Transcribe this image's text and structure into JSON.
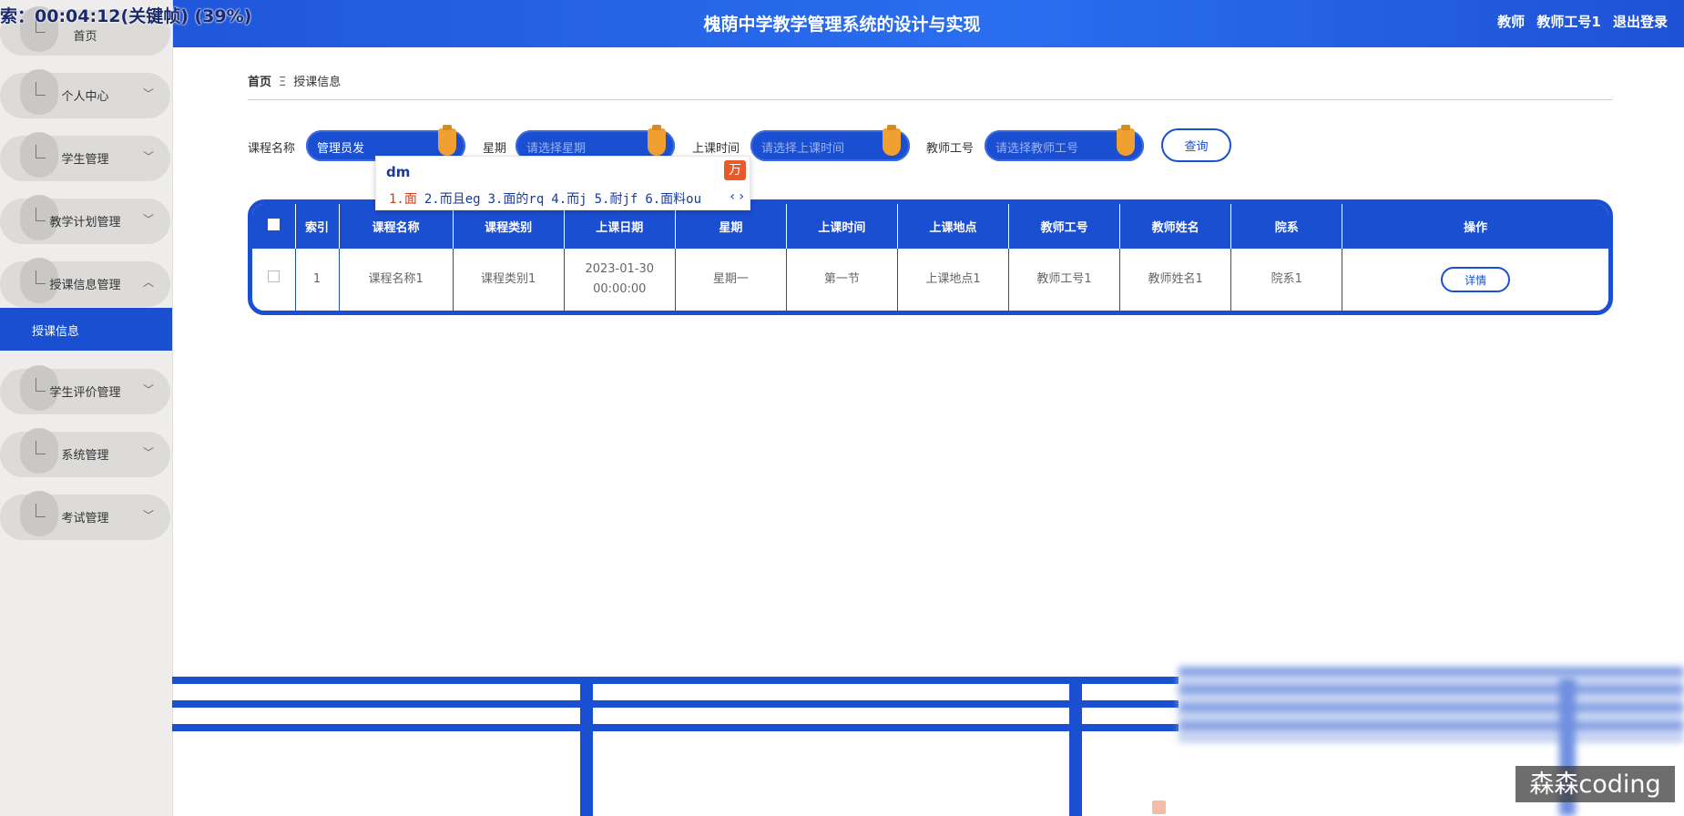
{
  "overlay_timestamp": "索：00:04:12(关键帧) (39%)",
  "header": {
    "title": "槐荫中学教学管理系统的设计与实现",
    "user_role": "教师",
    "user_id": "教师工号1",
    "logout": "退出登录"
  },
  "sidebar": {
    "items": [
      {
        "label": "首页"
      },
      {
        "label": "个人中心",
        "chevron": "﹀"
      },
      {
        "label": "学生管理",
        "chevron": "﹀"
      },
      {
        "label": "教学计划管理",
        "chevron": "﹀"
      },
      {
        "label": "授课信息管理",
        "chevron": "︿"
      },
      {
        "label": "学生评价管理",
        "chevron": "﹀"
      },
      {
        "label": "系统管理",
        "chevron": "﹀"
      },
      {
        "label": "考试管理",
        "chevron": "﹀"
      }
    ],
    "active_sub": "授课信息"
  },
  "breadcrumb": {
    "home": "首页",
    "separator": "Ξ",
    "current": "授课信息"
  },
  "search": {
    "course_label": "课程名称",
    "course_value": "管理员发",
    "weekday_label": "星期",
    "weekday_placeholder": "请选择星期",
    "time_label": "上课时间",
    "time_placeholder": "请选择上课时间",
    "teacher_label": "教师工号",
    "teacher_placeholder": "请选择教师工号",
    "query_button": "查询"
  },
  "ime": {
    "composition": "dm",
    "logo": "万",
    "candidates": [
      "1.面",
      "2.而且eg",
      "3.面的rq",
      "4.而j",
      "5.耐jf",
      "6.面料ou"
    ],
    "nav": "‹ ›"
  },
  "table": {
    "headers": [
      "索引",
      "课程名称",
      "课程类别",
      "上课日期",
      "星期",
      "上课时间",
      "上课地点",
      "教师工号",
      "教师姓名",
      "院系",
      "操作"
    ],
    "rows": [
      {
        "index": "1",
        "course_name": "课程名称1",
        "course_type": "课程类别1",
        "date": "2023-01-30 00:00:00",
        "weekday": "星期一",
        "time": "第一节",
        "location": "上课地点1",
        "teacher_id": "教师工号1",
        "teacher_name": "教师姓名1",
        "department": "院系1",
        "action": "详情"
      }
    ]
  },
  "watermark": "森森coding",
  "colors": {
    "primary": "#1a4fd1",
    "accent": "#f0a030",
    "sidebar_bg": "#eeedeb"
  }
}
